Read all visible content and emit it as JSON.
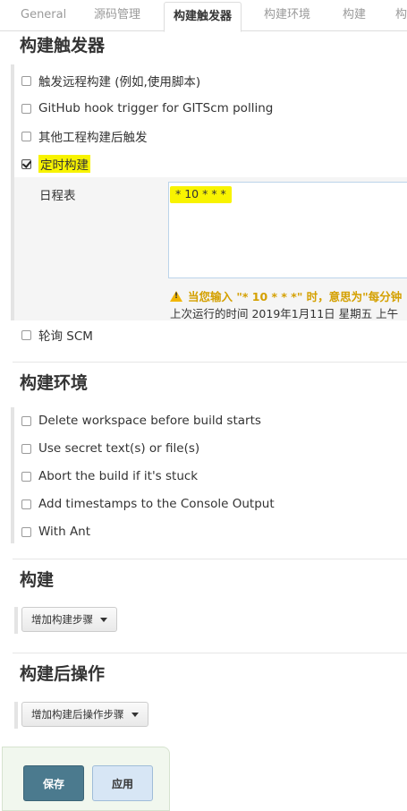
{
  "tabs": [
    {
      "label": "General"
    },
    {
      "label": "源码管理"
    },
    {
      "label": "构建触发器"
    },
    {
      "label": "构建环境"
    },
    {
      "label": "构建"
    },
    {
      "label": "构"
    }
  ],
  "triggers": {
    "title": "构建触发器",
    "options": [
      {
        "label": "触发远程构建 (例如,使用脚本)",
        "checked": false
      },
      {
        "label": "GitHub hook trigger for GITScm polling",
        "checked": false
      },
      {
        "label": "其他工程构建后触发",
        "checked": false
      },
      {
        "label": "定时构建",
        "checked": true
      },
      {
        "label": "轮询 SCM",
        "checked": false
      }
    ],
    "schedule": {
      "label": "日程表",
      "value": "* 10 * * *",
      "warning": "当您输入 \"* 10 * * *\" 时，意思为\"每分钟",
      "last_run": "上次运行的时间 2019年1月11日 星期五 上午"
    }
  },
  "build_env": {
    "title": "构建环境",
    "options": [
      {
        "label": "Delete workspace before build starts",
        "checked": false
      },
      {
        "label": "Use secret text(s) or file(s)",
        "checked": false
      },
      {
        "label": "Abort the build if it's stuck",
        "checked": false
      },
      {
        "label": "Add timestamps to the Console Output",
        "checked": false
      },
      {
        "label": "With Ant",
        "checked": false
      }
    ]
  },
  "build": {
    "title": "构建",
    "add_step": "增加构建步骤"
  },
  "post_build": {
    "title": "构建后操作",
    "add_step": "增加构建后操作步骤"
  },
  "actions": {
    "save": "保存",
    "apply": "应用"
  },
  "colors": {
    "highlight": "#f8f300",
    "save_button": "#4b7a8e",
    "apply_button": "#d7e6f5",
    "warning_text": "#d4a000"
  }
}
